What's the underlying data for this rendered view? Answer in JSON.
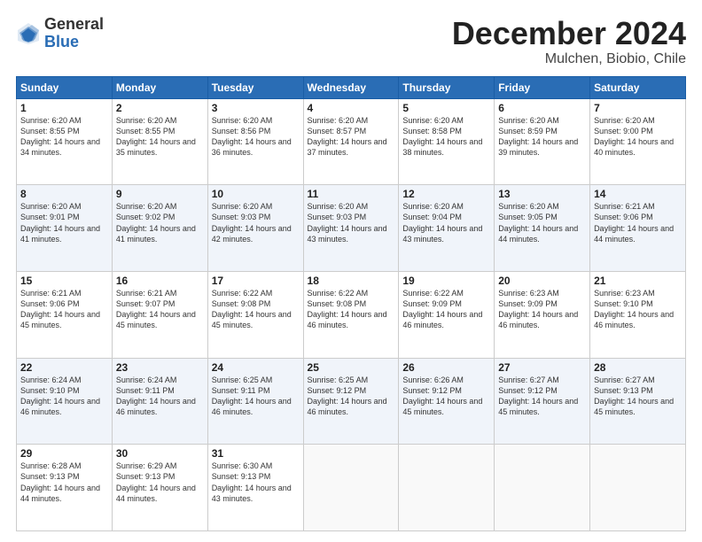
{
  "logo": {
    "general": "General",
    "blue": "Blue"
  },
  "title": "December 2024",
  "location": "Mulchen, Biobio, Chile",
  "days_header": [
    "Sunday",
    "Monday",
    "Tuesday",
    "Wednesday",
    "Thursday",
    "Friday",
    "Saturday"
  ],
  "weeks": [
    [
      {
        "day": "1",
        "sunrise": "6:20 AM",
        "sunset": "8:55 PM",
        "daylight": "14 hours and 34 minutes."
      },
      {
        "day": "2",
        "sunrise": "6:20 AM",
        "sunset": "8:55 PM",
        "daylight": "14 hours and 35 minutes."
      },
      {
        "day": "3",
        "sunrise": "6:20 AM",
        "sunset": "8:56 PM",
        "daylight": "14 hours and 36 minutes."
      },
      {
        "day": "4",
        "sunrise": "6:20 AM",
        "sunset": "8:57 PM",
        "daylight": "14 hours and 37 minutes."
      },
      {
        "day": "5",
        "sunrise": "6:20 AM",
        "sunset": "8:58 PM",
        "daylight": "14 hours and 38 minutes."
      },
      {
        "day": "6",
        "sunrise": "6:20 AM",
        "sunset": "8:59 PM",
        "daylight": "14 hours and 39 minutes."
      },
      {
        "day": "7",
        "sunrise": "6:20 AM",
        "sunset": "9:00 PM",
        "daylight": "14 hours and 40 minutes."
      }
    ],
    [
      {
        "day": "8",
        "sunrise": "6:20 AM",
        "sunset": "9:01 PM",
        "daylight": "14 hours and 41 minutes."
      },
      {
        "day": "9",
        "sunrise": "6:20 AM",
        "sunset": "9:02 PM",
        "daylight": "14 hours and 41 minutes."
      },
      {
        "day": "10",
        "sunrise": "6:20 AM",
        "sunset": "9:03 PM",
        "daylight": "14 hours and 42 minutes."
      },
      {
        "day": "11",
        "sunrise": "6:20 AM",
        "sunset": "9:03 PM",
        "daylight": "14 hours and 43 minutes."
      },
      {
        "day": "12",
        "sunrise": "6:20 AM",
        "sunset": "9:04 PM",
        "daylight": "14 hours and 43 minutes."
      },
      {
        "day": "13",
        "sunrise": "6:20 AM",
        "sunset": "9:05 PM",
        "daylight": "14 hours and 44 minutes."
      },
      {
        "day": "14",
        "sunrise": "6:21 AM",
        "sunset": "9:06 PM",
        "daylight": "14 hours and 44 minutes."
      }
    ],
    [
      {
        "day": "15",
        "sunrise": "6:21 AM",
        "sunset": "9:06 PM",
        "daylight": "14 hours and 45 minutes."
      },
      {
        "day": "16",
        "sunrise": "6:21 AM",
        "sunset": "9:07 PM",
        "daylight": "14 hours and 45 minutes."
      },
      {
        "day": "17",
        "sunrise": "6:22 AM",
        "sunset": "9:08 PM",
        "daylight": "14 hours and 45 minutes."
      },
      {
        "day": "18",
        "sunrise": "6:22 AM",
        "sunset": "9:08 PM",
        "daylight": "14 hours and 46 minutes."
      },
      {
        "day": "19",
        "sunrise": "6:22 AM",
        "sunset": "9:09 PM",
        "daylight": "14 hours and 46 minutes."
      },
      {
        "day": "20",
        "sunrise": "6:23 AM",
        "sunset": "9:09 PM",
        "daylight": "14 hours and 46 minutes."
      },
      {
        "day": "21",
        "sunrise": "6:23 AM",
        "sunset": "9:10 PM",
        "daylight": "14 hours and 46 minutes."
      }
    ],
    [
      {
        "day": "22",
        "sunrise": "6:24 AM",
        "sunset": "9:10 PM",
        "daylight": "14 hours and 46 minutes."
      },
      {
        "day": "23",
        "sunrise": "6:24 AM",
        "sunset": "9:11 PM",
        "daylight": "14 hours and 46 minutes."
      },
      {
        "day": "24",
        "sunrise": "6:25 AM",
        "sunset": "9:11 PM",
        "daylight": "14 hours and 46 minutes."
      },
      {
        "day": "25",
        "sunrise": "6:25 AM",
        "sunset": "9:12 PM",
        "daylight": "14 hours and 46 minutes."
      },
      {
        "day": "26",
        "sunrise": "6:26 AM",
        "sunset": "9:12 PM",
        "daylight": "14 hours and 45 minutes."
      },
      {
        "day": "27",
        "sunrise": "6:27 AM",
        "sunset": "9:12 PM",
        "daylight": "14 hours and 45 minutes."
      },
      {
        "day": "28",
        "sunrise": "6:27 AM",
        "sunset": "9:13 PM",
        "daylight": "14 hours and 45 minutes."
      }
    ],
    [
      {
        "day": "29",
        "sunrise": "6:28 AM",
        "sunset": "9:13 PM",
        "daylight": "14 hours and 44 minutes."
      },
      {
        "day": "30",
        "sunrise": "6:29 AM",
        "sunset": "9:13 PM",
        "daylight": "14 hours and 44 minutes."
      },
      {
        "day": "31",
        "sunrise": "6:30 AM",
        "sunset": "9:13 PM",
        "daylight": "14 hours and 43 minutes."
      },
      null,
      null,
      null,
      null
    ]
  ]
}
